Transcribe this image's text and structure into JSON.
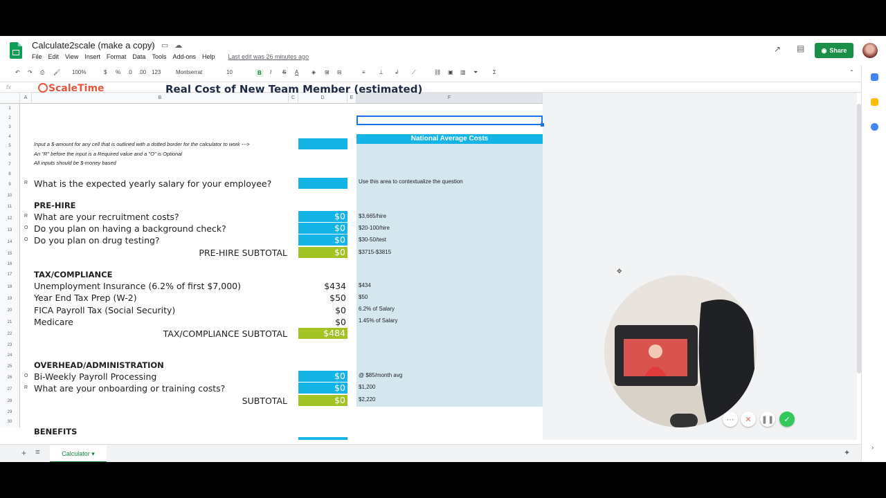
{
  "titlebar": {
    "doc_title": "Calculate2scale (make a copy)",
    "menu": [
      "File",
      "Edit",
      "View",
      "Insert",
      "Format",
      "Data",
      "Tools",
      "Add-ons",
      "Help"
    ],
    "last_edit": "Last edit was 26 minutes ago",
    "share_label": "Share"
  },
  "toolbar": {
    "zoom": "100%",
    "currency": "$",
    "percent": "%",
    "dec_less": ".0",
    "dec_more": ".00",
    "format": "123",
    "font": "Montserrat",
    "font_size": "10",
    "bold": "B",
    "italic": "I",
    "strike": "S",
    "text_color": "A"
  },
  "formula_bar": {
    "fx": "fx"
  },
  "columns": [
    "A",
    "B",
    "C",
    "D",
    "E",
    "F"
  ],
  "rows": [
    "1",
    "2",
    "3",
    "4",
    "5",
    "6",
    "7",
    "8",
    "9",
    "10",
    "11",
    "12",
    "13",
    "14",
    "15",
    "16",
    "17",
    "18",
    "19",
    "20",
    "21",
    "22",
    "23",
    "24",
    "25",
    "26",
    "27",
    "28",
    "29",
    "30"
  ],
  "sheet": {
    "logo_text": "ScaleTime",
    "title": "Real Cost of New Team Member (estimated)",
    "notes": [
      "Input a $-amount for any cell that is outlined with a dotted border for the calculator to work  --->",
      "An \"R\" before the input is a Required value and a \"O\" is Optional",
      "All inputs should be $-money based"
    ],
    "national_header": "National Average Costs",
    "national_sub": "Use this area to contextualize the question",
    "salary_question": "What is the expected yearly salary for your employee?",
    "salary_flag": "R",
    "prehire": {
      "header": "PRE-HIRE",
      "items": [
        {
          "flag": "R",
          "label": "What are your recruitment costs?",
          "value": "$0",
          "ref": "$3,665/hire"
        },
        {
          "flag": "O",
          "label": "Do you plan on having a background check?",
          "value": "$0",
          "ref": "$20-100/hire"
        },
        {
          "flag": "O",
          "label": "Do you plan on drug testing?",
          "value": "$0",
          "ref": "$30-50/test"
        }
      ],
      "subtotal_label": "PRE-HIRE SUBTOTAL",
      "subtotal_value": "$0",
      "subtotal_ref": "$3715-$3815"
    },
    "tax": {
      "header": "TAX/COMPLIANCE",
      "items": [
        {
          "label": "Unemployment Insurance (6.2% of first $7,000)",
          "value": "$434",
          "ref": "$434"
        },
        {
          "label": "Year End Tax Prep (W-2)",
          "value": "$50",
          "ref": "$50"
        },
        {
          "label": "FICA Payroll Tax (Social Security)",
          "value": "$0",
          "ref": "6.2% of Salary"
        },
        {
          "label": "Medicare",
          "value": "$0",
          "ref": "1.45% of Salary"
        }
      ],
      "subtotal_label": "TAX/COMPLIANCE SUBTOTAL",
      "subtotal_value": "$484"
    },
    "overhead": {
      "header": "OVERHEAD/ADMINISTRATION",
      "items": [
        {
          "flag": "O",
          "label": "Bi-Weekly Payroll Processing",
          "value": "$0",
          "ref": "@ $85/month avg"
        },
        {
          "flag": "R",
          "label": "What are your onboarding or training costs?",
          "value": "$0",
          "ref": "$1,200"
        }
      ],
      "subtotal_label": "SUBTOTAL",
      "subtotal_value": "$0",
      "subtotal_ref": "$2,220"
    },
    "benefits_header": "BENEFITS"
  },
  "sheet_tab": "Calculator",
  "colors": {
    "input_blue": "#14b4e6",
    "subtotal_green": "#a3c224",
    "context_bg": "#d4e7ef",
    "brand_orange": "#e8543a",
    "share_green": "#1a8f48"
  }
}
